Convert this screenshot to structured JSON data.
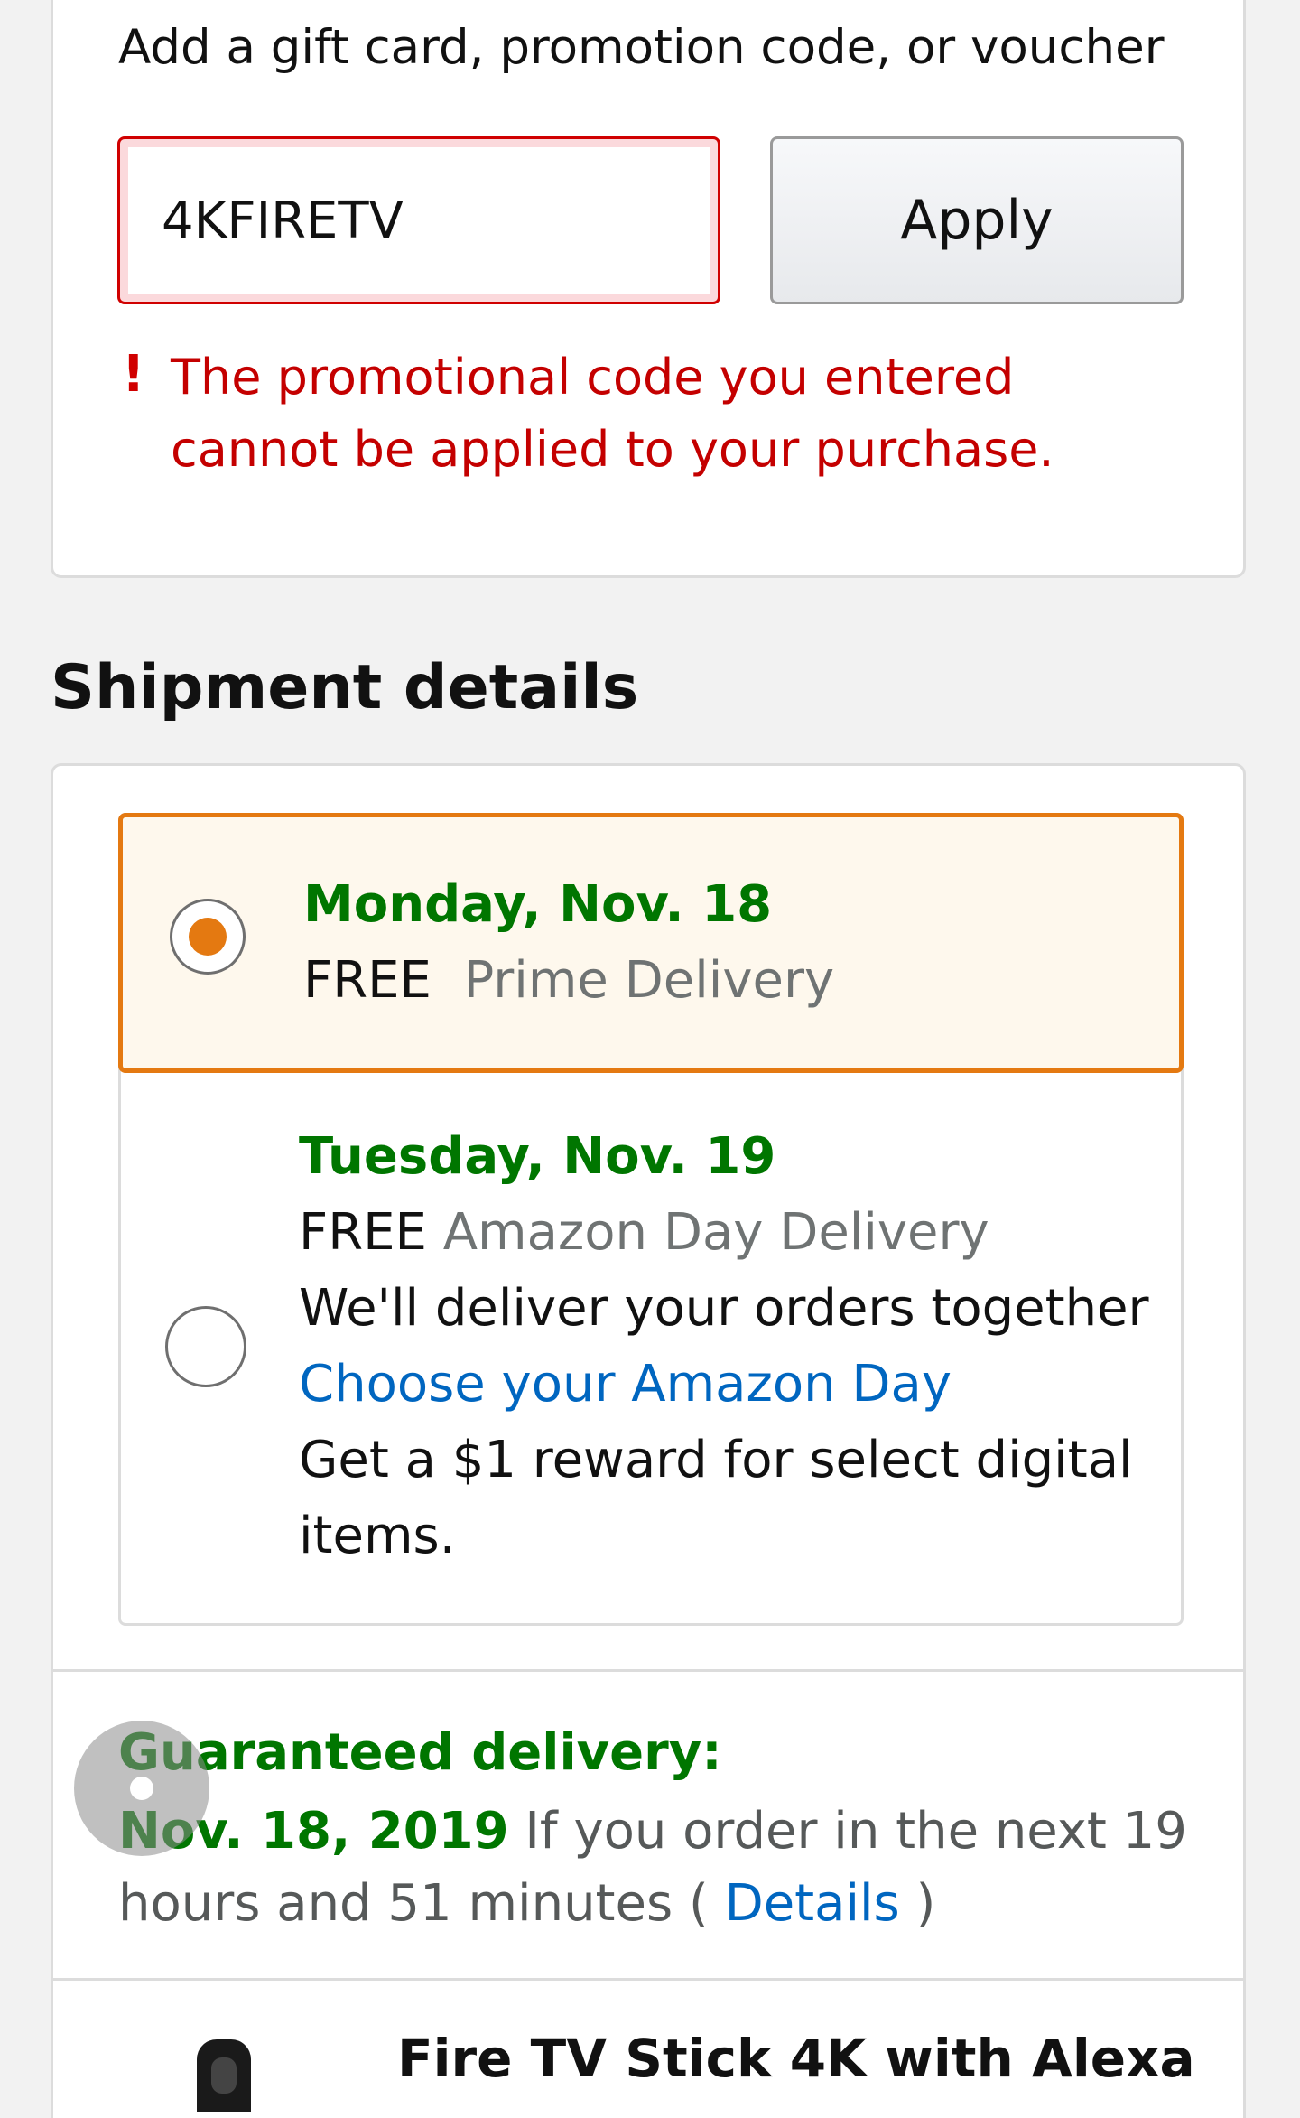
{
  "promo": {
    "label": "Add a gift card, promotion code, or voucher",
    "input_value": "4KFIRETV",
    "apply_label": "Apply",
    "error_icon": "!",
    "error_text": "The promotional code you entered cannot be applied to your purchase."
  },
  "shipment": {
    "title": "Shipment details",
    "options": [
      {
        "date": "Monday, Nov. 18",
        "price": "FREE",
        "method": "Prime Delivery",
        "selected": true
      },
      {
        "date": "Tuesday, Nov. 19",
        "price": "FREE",
        "method": "Amazon Day Delivery",
        "note": "We'll deliver your orders together",
        "link": "Choose your Amazon Day",
        "reward_line1": "Get a $1 reward for select digital",
        "reward_line2": "items.",
        "selected": false
      }
    ],
    "guarantee": {
      "title": "Guaranteed delivery:",
      "date": "Nov. 18, 2019",
      "text_before": " If you order in the next 19 hours and 51 minutes ( ",
      "details_link": "Details",
      "text_after": " )"
    }
  },
  "product": {
    "title": "Fire TV Stick 4K with Alexa"
  },
  "colors": {
    "accent_orange": "#e47911",
    "success_green": "#007600",
    "error_red": "#c40000",
    "link_blue": "#0066c0"
  }
}
